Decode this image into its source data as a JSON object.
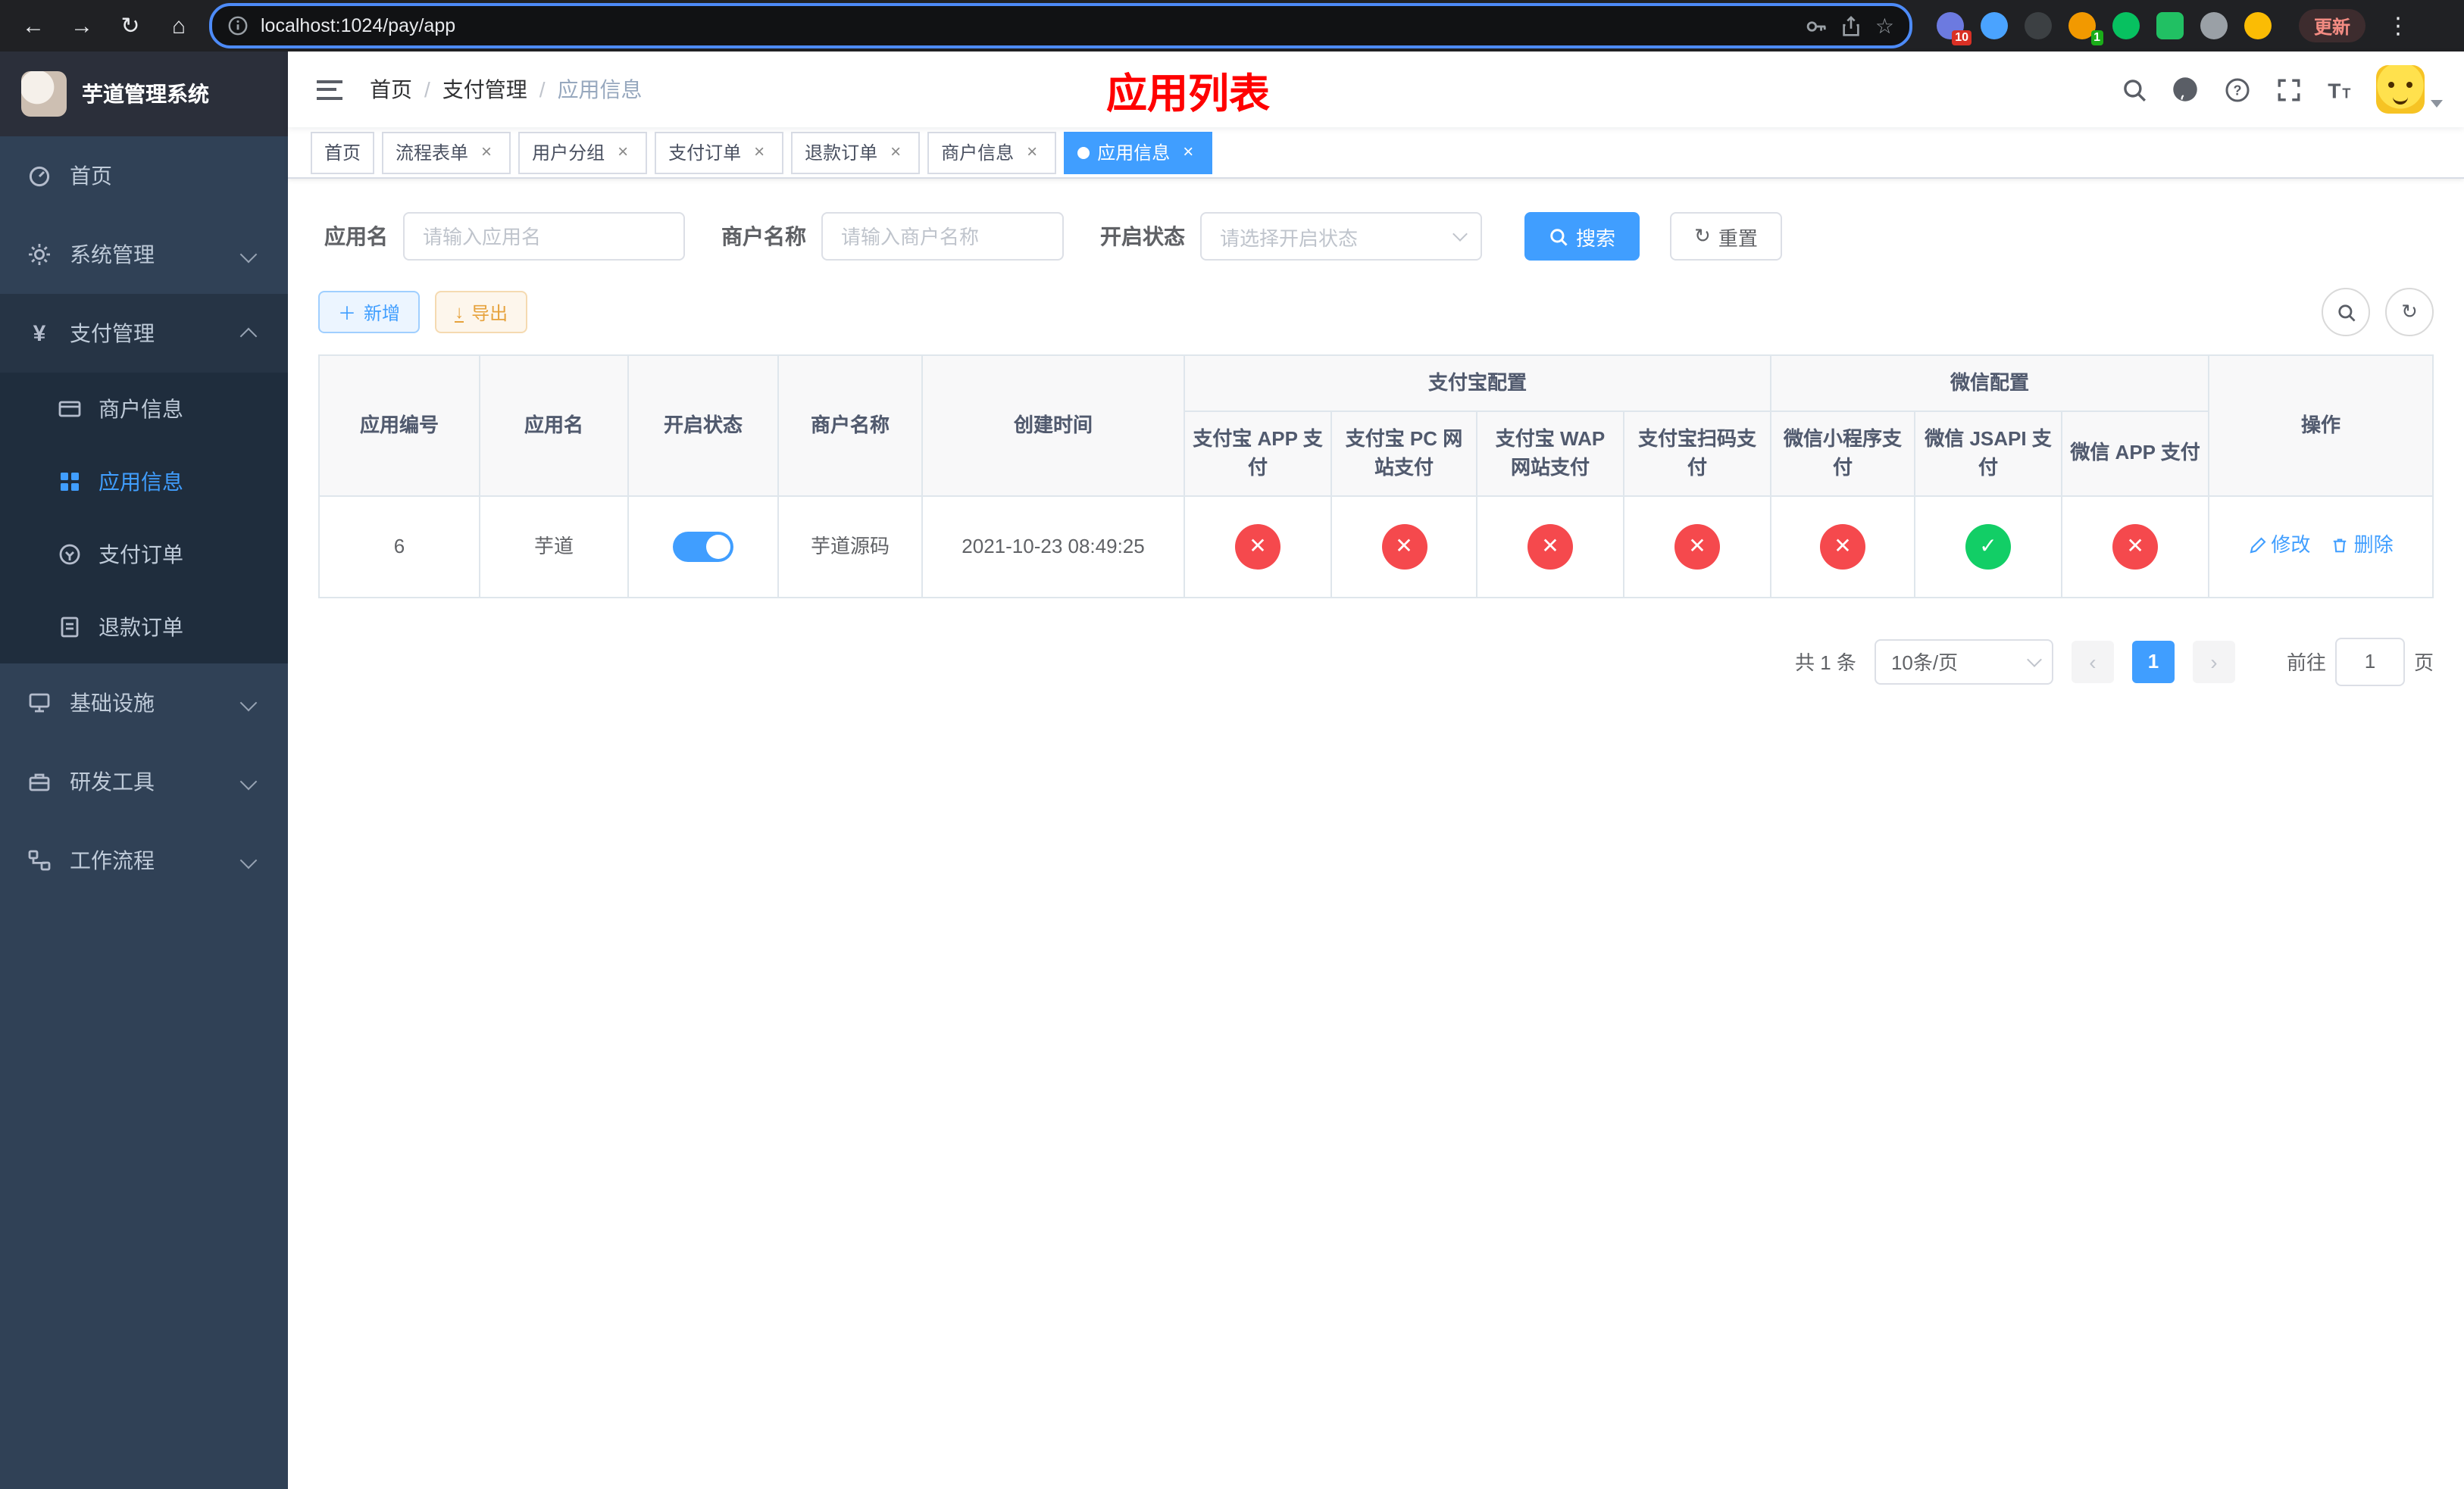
{
  "browser": {
    "url": "localhost:1024/pay/app",
    "update_label": "更新",
    "extension_badge_red": "10",
    "extension_badge_green": "1"
  },
  "sidebar": {
    "title": "芋道管理系统",
    "menu": [
      {
        "label": "首页"
      },
      {
        "label": "系统管理"
      },
      {
        "label": "支付管理"
      },
      {
        "label": "基础设施"
      },
      {
        "label": "研发工具"
      },
      {
        "label": "工作流程"
      }
    ],
    "submenu_pay": [
      {
        "label": "商户信息"
      },
      {
        "label": "应用信息"
      },
      {
        "label": "支付订单"
      },
      {
        "label": "退款订单"
      }
    ]
  },
  "header": {
    "breadcrumb": [
      "首页",
      "支付管理",
      "应用信息"
    ],
    "page_title": "应用列表"
  },
  "tags": [
    "首页",
    "流程表单",
    "用户分组",
    "支付订单",
    "退款订单",
    "商户信息",
    "应用信息"
  ],
  "filters": {
    "app_name_label": "应用名",
    "app_name_placeholder": "请输入应用名",
    "merchant_label": "商户名称",
    "merchant_placeholder": "请输入商户名称",
    "status_label": "开启状态",
    "status_placeholder": "请选择开启状态",
    "search_button": "搜索",
    "reset_button": "重置"
  },
  "toolbar": {
    "add_button": "新增",
    "export_button": "导出"
  },
  "table": {
    "col_id": "应用编号",
    "col_app": "应用名",
    "col_status": "开启状态",
    "col_merchant": "商户名称",
    "col_created": "创建时间",
    "group_alipay": "支付宝配置",
    "group_wechat": "微信配置",
    "col_alipay_app": "支付宝 APP 支付",
    "col_alipay_pc": "支付宝 PC 网站支付",
    "col_alipay_wap": "支付宝 WAP 网站支付",
    "col_alipay_qr": "支付宝扫码支付",
    "col_wx_mini": "微信小程序支付",
    "col_wx_jsapi": "微信 JSAPI 支付",
    "col_wx_app": "微信 APP 支付",
    "col_ops": "操作",
    "rows": [
      {
        "id": "6",
        "app_name": "芋道",
        "enabled": true,
        "merchant": "芋道源码",
        "created_at": "2021-10-23 08:49:25",
        "configs": [
          false,
          false,
          false,
          false,
          false,
          true,
          false
        ],
        "edit_label": "修改",
        "delete_label": "删除"
      }
    ]
  },
  "pagination": {
    "total_text": "共 1 条",
    "page_size_text": "10条/页",
    "page": "1",
    "prev": "‹",
    "next": "›",
    "goto_label": "前往",
    "goto_value": "1",
    "goto_suffix": "页"
  },
  "colors": {
    "primary": "#409eff",
    "success": "#12ce66",
    "danger": "#f5494d",
    "page_title_red": "#ff0000",
    "sidebar_bg": "#304156",
    "active_tag_bg": "#409eff"
  }
}
